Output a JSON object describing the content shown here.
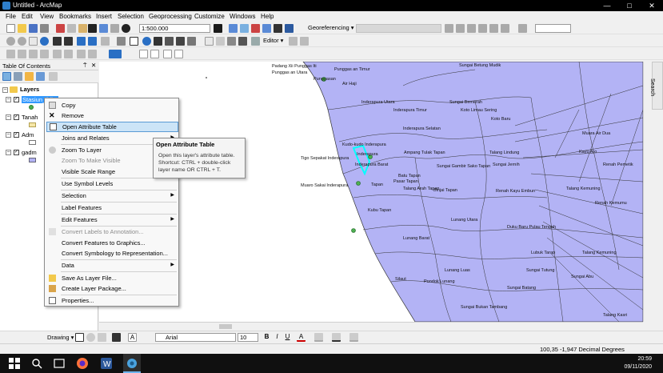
{
  "window": {
    "title": "Untitled - ArcMap"
  },
  "menu": [
    "File",
    "Edit",
    "View",
    "Bookmarks",
    "Insert",
    "Selection",
    "Geoprocessing",
    "Customize",
    "Windows",
    "Help"
  ],
  "toolbar": {
    "scale": "1:500.000",
    "georeferencing_label": "Georeferencing ▾",
    "editor_label": "Editor ▾"
  },
  "toc": {
    "title": "Table Of Contents",
    "pin": "⍑",
    "close": "✕",
    "root": "Layers",
    "layers": [
      {
        "name": "Stasiun_lklim",
        "selected": true
      },
      {
        "name": "Tanah"
      },
      {
        "name": "Adm"
      },
      {
        "name": "gadm"
      }
    ]
  },
  "context_menu": {
    "items": [
      {
        "label": "Copy",
        "icon": "copy-icon"
      },
      {
        "label": "Remove",
        "icon": "remove-icon"
      },
      {
        "label": "Open Attribute Table",
        "icon": "table-icon",
        "highlighted": true
      },
      {
        "label": "Joins and Relates",
        "submenu": true
      },
      {
        "label": "Zoom To Layer",
        "icon": "zoom-layer-icon"
      },
      {
        "label": "Zoom To Make Visible",
        "disabled": true
      },
      {
        "label": "Visible Scale Range",
        "submenu": true
      },
      {
        "label": "Use Symbol Levels"
      },
      {
        "label": "Selection",
        "submenu": true
      },
      {
        "label": "Label Features"
      },
      {
        "label": "Edit Features",
        "submenu": true
      },
      {
        "label": "Convert Labels to Annotation...",
        "disabled": true
      },
      {
        "label": "Convert Features to Graphics..."
      },
      {
        "label": "Convert Symbology to Representation..."
      },
      {
        "label": "Data",
        "submenu": true
      },
      {
        "label": "Save As Layer File..."
      },
      {
        "label": "Create Layer Package..."
      },
      {
        "label": "Properties..."
      }
    ]
  },
  "tooltip": {
    "title": "Open Attribute Table",
    "body": "Open this layer's attribute table. Shortcut: CTRL + double-click layer name OR CTRL + T."
  },
  "map_labels": [
    "Padang Xii Punggas Iti",
    "Punggas an Timur",
    "Punggas an Utara",
    "Punggasan",
    "Air Haji",
    "Inderapura Utara",
    "Inderapura Timur",
    "Inderapura Selatan",
    "Kudo-kudo Inderapura",
    "Inderapura",
    "Tigo Sepakat Inderapura",
    "Inderapura Barat",
    "Muaro Sakai Inderapura",
    "Tapan",
    "Kubu Tapan",
    "Ampang Tulak Tapan",
    "Sungai Gambir Sako Tapan",
    "Batu Tapan",
    "Pasar Tapan",
    "Talang Arah Tapan",
    "Binjai Tapan",
    "Lunang Barat",
    "Lunang Utara",
    "Silaut",
    "Lunang Luas",
    "Sungai Betung Mudik",
    "Sungai Bemerah",
    "Sungai Jernih",
    "Talang Lindung",
    "Renah Kayu Embun",
    "Talang Kemuning",
    "Muara Air Dua",
    "Duku Baru Pulau Tengah",
    "Lubuk Tarap",
    "Sungai Tutung",
    "Sungai Abu",
    "Sungai Bukan Tambang",
    "Koto Baru",
    "Talang Kasri",
    "Pondok Lunang",
    "Sungai Batang",
    "Kayu Aro",
    "Renah Pemetik",
    "Renah Kemumu",
    "Koto Limau Sering",
    "Talang Kemuning"
  ],
  "drawing": {
    "label": "Drawing ▾",
    "font": "Arial",
    "size": "10"
  },
  "status": {
    "coords": "100,35  -1,947 Decimal Degrees"
  },
  "taskbar": {
    "time": "20:59",
    "date": "09/11/2020"
  },
  "colors": {
    "map_fill": "#b3b3f5",
    "highlight": "#cce4f7",
    "titlebar": "#000000",
    "taskbar": "#101010",
    "selection": "#00ffff"
  }
}
